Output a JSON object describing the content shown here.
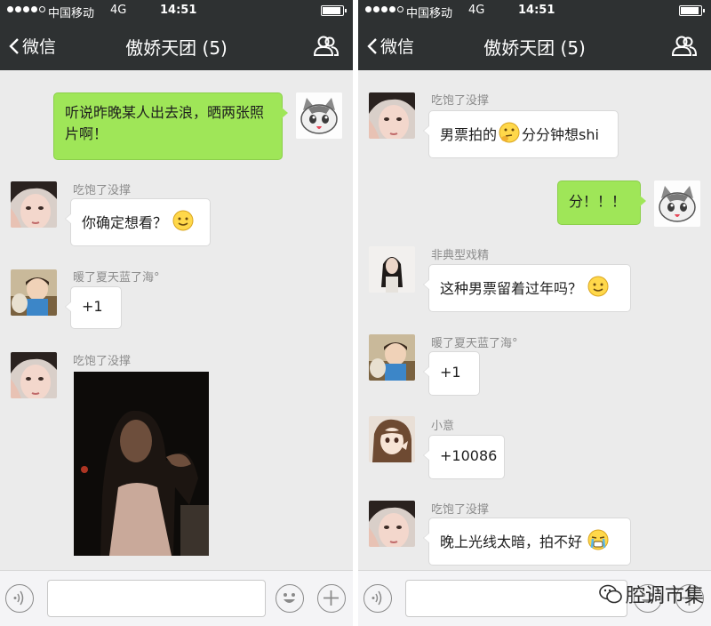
{
  "status": {
    "carrier": "中国移动",
    "network": "4G",
    "time": "14:51"
  },
  "nav": {
    "back_label": "微信",
    "title": "傲娇天团 (5)"
  },
  "left_messages": [
    {
      "side": "out",
      "text": "听说昨晚某人出去浪，晒两张照片啊！"
    },
    {
      "side": "in",
      "sender": "吃饱了没撑",
      "text": "你确定想看？"
    },
    {
      "side": "in",
      "sender": "暖了夏天蓝了海°",
      "text": "+1"
    },
    {
      "side": "in",
      "sender": "吃饱了没撑",
      "image": "night-selfie-photo"
    }
  ],
  "right_messages": [
    {
      "side": "in",
      "sender": "吃饱了没撑",
      "text": "男票拍的",
      "text2": "分分钟想shi"
    },
    {
      "side": "out",
      "text": "分！！！"
    },
    {
      "side": "in",
      "sender": "非典型戏精",
      "text": "这种男票留着过年吗？"
    },
    {
      "side": "in",
      "sender": "暖了夏天蓝了海°",
      "text": "+1"
    },
    {
      "side": "in",
      "sender": "小意",
      "text": "+10086"
    },
    {
      "side": "in",
      "sender": "吃饱了没撑",
      "text": "晚上光线太暗，拍不好"
    }
  ],
  "watermark": "腔调市集",
  "colors": {
    "navbar": "#2e3132",
    "chat_bg": "#ebebeb",
    "out_bubble": "#9fe658",
    "in_bubble": "#ffffff"
  }
}
